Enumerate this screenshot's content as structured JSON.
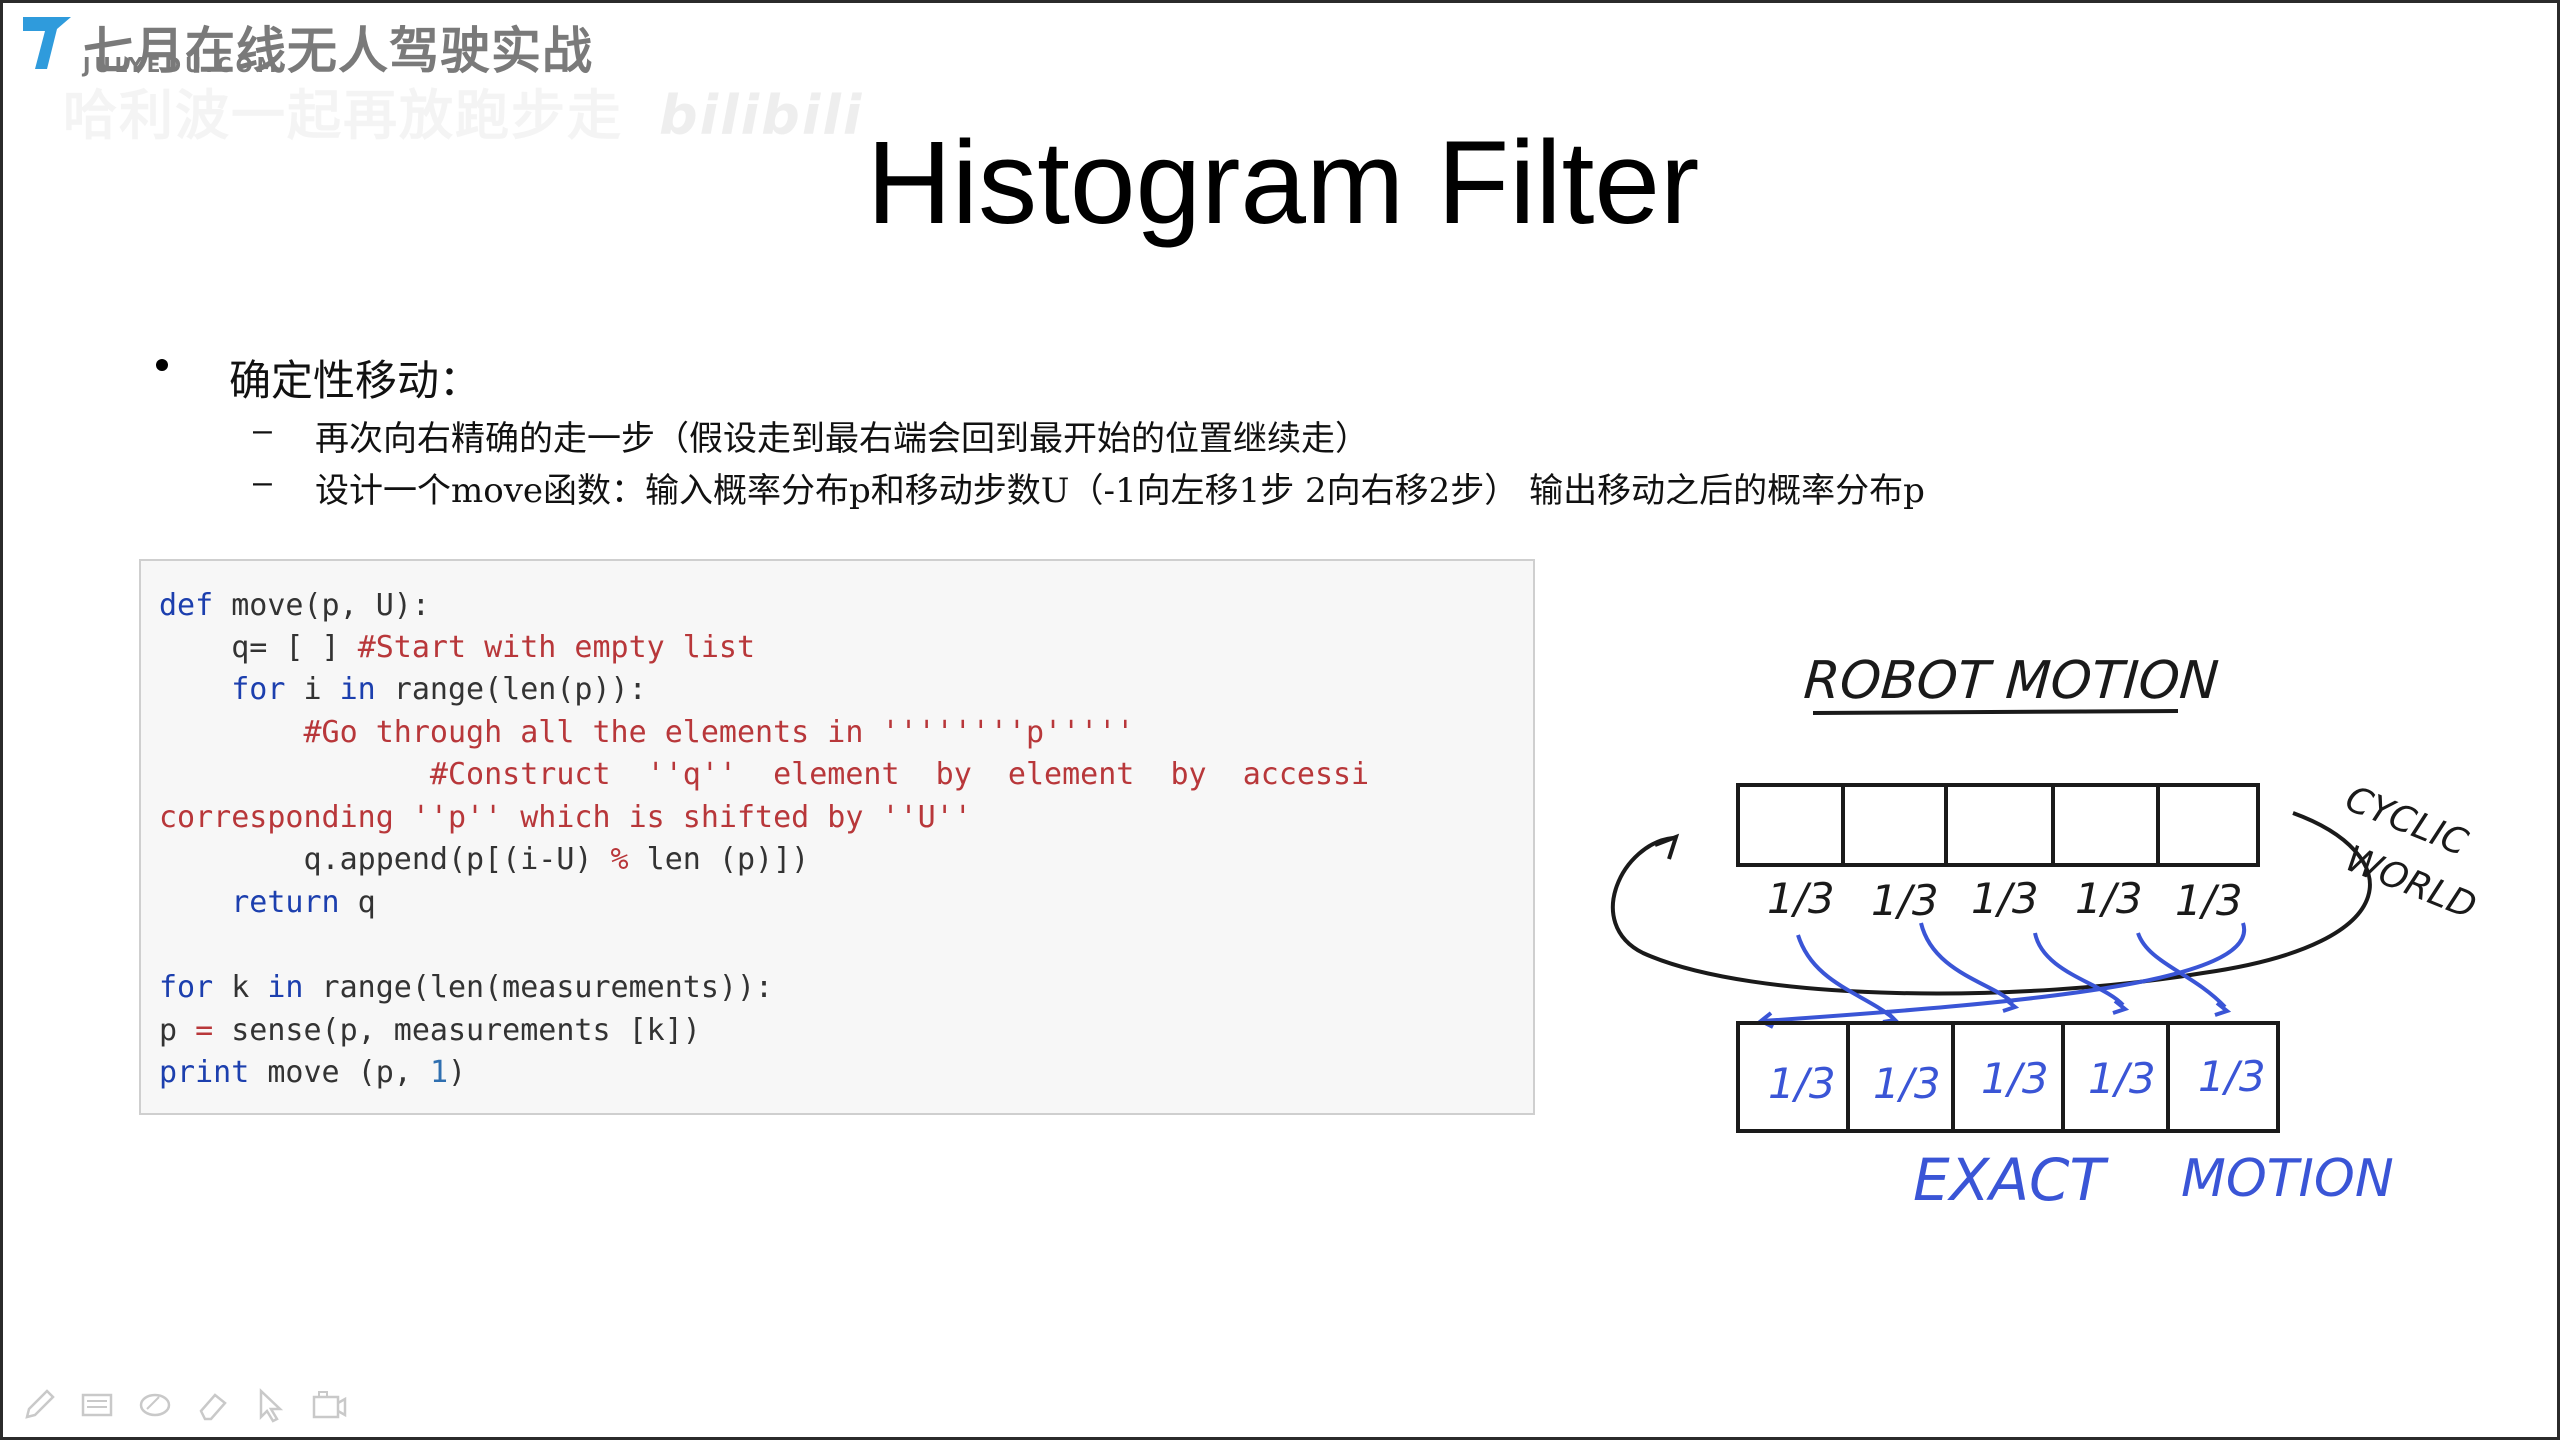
{
  "branding": {
    "title": "七月在线无人驾驶实战",
    "subtitle": "JULYEDU.COM",
    "watermark": "哈利波一起再放跑步走",
    "watermark_site": "bilibili"
  },
  "slide": {
    "title": "Histogram Filter",
    "bullet": "确定性移动：",
    "sub_items": [
      "再次向右精确的走一步（假设走到最右端会回到最开始的位置继续走）",
      "设计一个move函数：输入概率分布p和移动步数U（-1向左移1步 2向右移2步） 输出移动之后的概率分布p"
    ],
    "dash": "–"
  },
  "code": {
    "l1_kw": "def",
    "l1_rest": " move(p, U):",
    "l2_pre": "    q= [ ] ",
    "l2_cm": "#Start with empty list",
    "l3_kw1": "    for",
    "l3_mid": " i ",
    "l3_kw2": "in",
    "l3_rest": " range(len(p)):",
    "l4_cm": "        #Go through all the elements in ''''''''p'''''",
    "l5_cm": "               #Construct  ''q''  element  by  element  by  accessi",
    "l6_cm": "corresponding ''p'' which is shifted by ''U''",
    "l7_a": "        q.append(p[(i-U) ",
    "l7_op": "%",
    "l7_b": " len (p)])",
    "l8_kw": "    return",
    "l8_rest": " q",
    "l10_kw1": "for",
    "l10_mid": " k ",
    "l10_kw2": "in",
    "l10_rest": " range(len(measurements)):",
    "l11_a": "p ",
    "l11_op": "=",
    "l11_b": " sense(p, measurements [k])",
    "l12_kw": "print",
    "l12_rest": " move (p, ",
    "l12_num": "1",
    "l12_end": ")"
  },
  "diagram": {
    "heading": "ROBOT MOTION",
    "side_label_1": "CYCLIC",
    "side_label_2": "WORLD",
    "top_values": [
      "1/3",
      "1/3",
      "1/3",
      "1/3",
      "1/3"
    ],
    "bottom_values": [
      "1/3",
      "1/3",
      "1/3",
      "1/3",
      "1/3"
    ],
    "bottom_label_1": "EXACT",
    "bottom_label_2": "MOTION",
    "ink_color": "#1a1a1a",
    "blue_color": "#3a55d6"
  },
  "toolbar": {
    "tools": [
      "pen-icon",
      "whiteboard-icon",
      "eraser-oval-icon",
      "eraser-icon",
      "pointer-icon",
      "camera-icon"
    ]
  }
}
